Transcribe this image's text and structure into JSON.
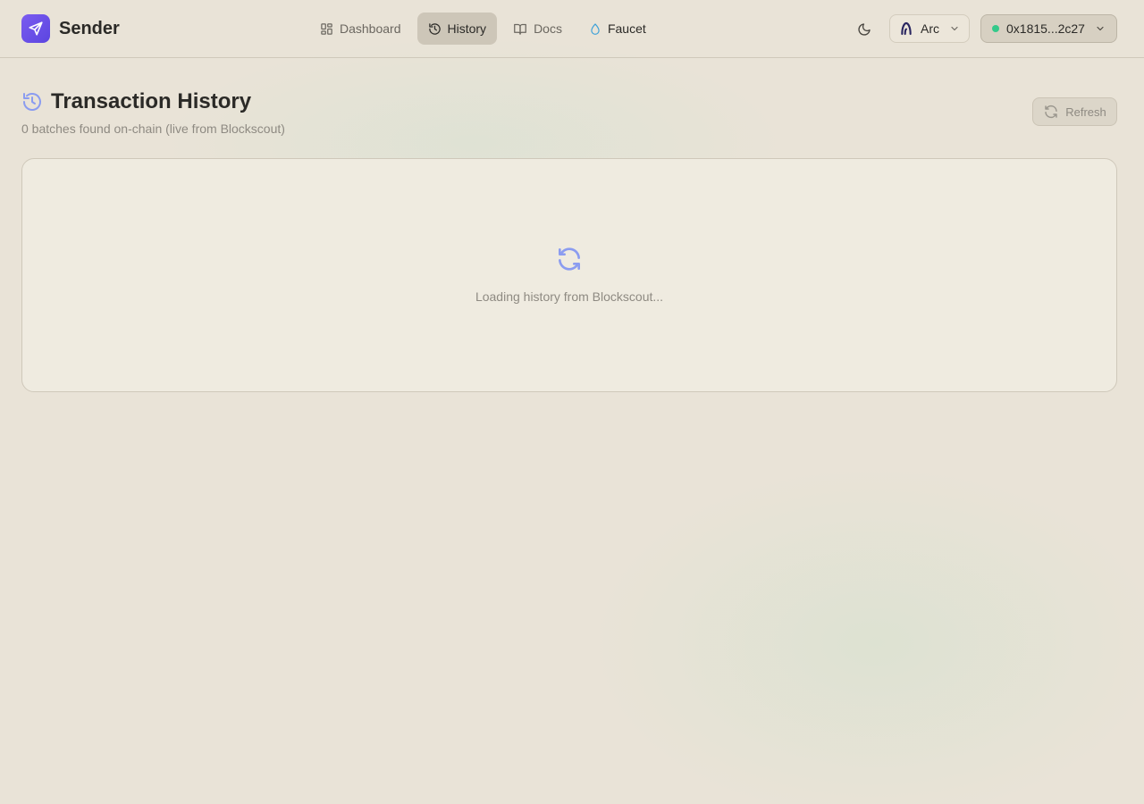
{
  "app": {
    "name": "Sender"
  },
  "nav": {
    "items": [
      {
        "label": "Dashboard",
        "icon": "dashboard-icon"
      },
      {
        "label": "History",
        "icon": "history-icon",
        "active": true
      },
      {
        "label": "Docs",
        "icon": "book-icon"
      },
      {
        "label": "Faucet",
        "icon": "droplet-icon"
      }
    ]
  },
  "header": {
    "theme_icon": "moon-icon",
    "network": {
      "label": "Arc",
      "icon": "arc-icon"
    },
    "wallet": {
      "address": "0x1815...2c27",
      "status_color": "#34c98a"
    }
  },
  "page": {
    "title": "Transaction History",
    "subtitle": "0 batches found on-chain (live from Blockscout)",
    "refresh_label": "Refresh"
  },
  "history": {
    "loading_text": "Loading history from Blockscout..."
  },
  "colors": {
    "accent": "#7b5cf0",
    "icon_blue": "#8b9cf0",
    "faucet_blue": "#3aa0d8"
  }
}
